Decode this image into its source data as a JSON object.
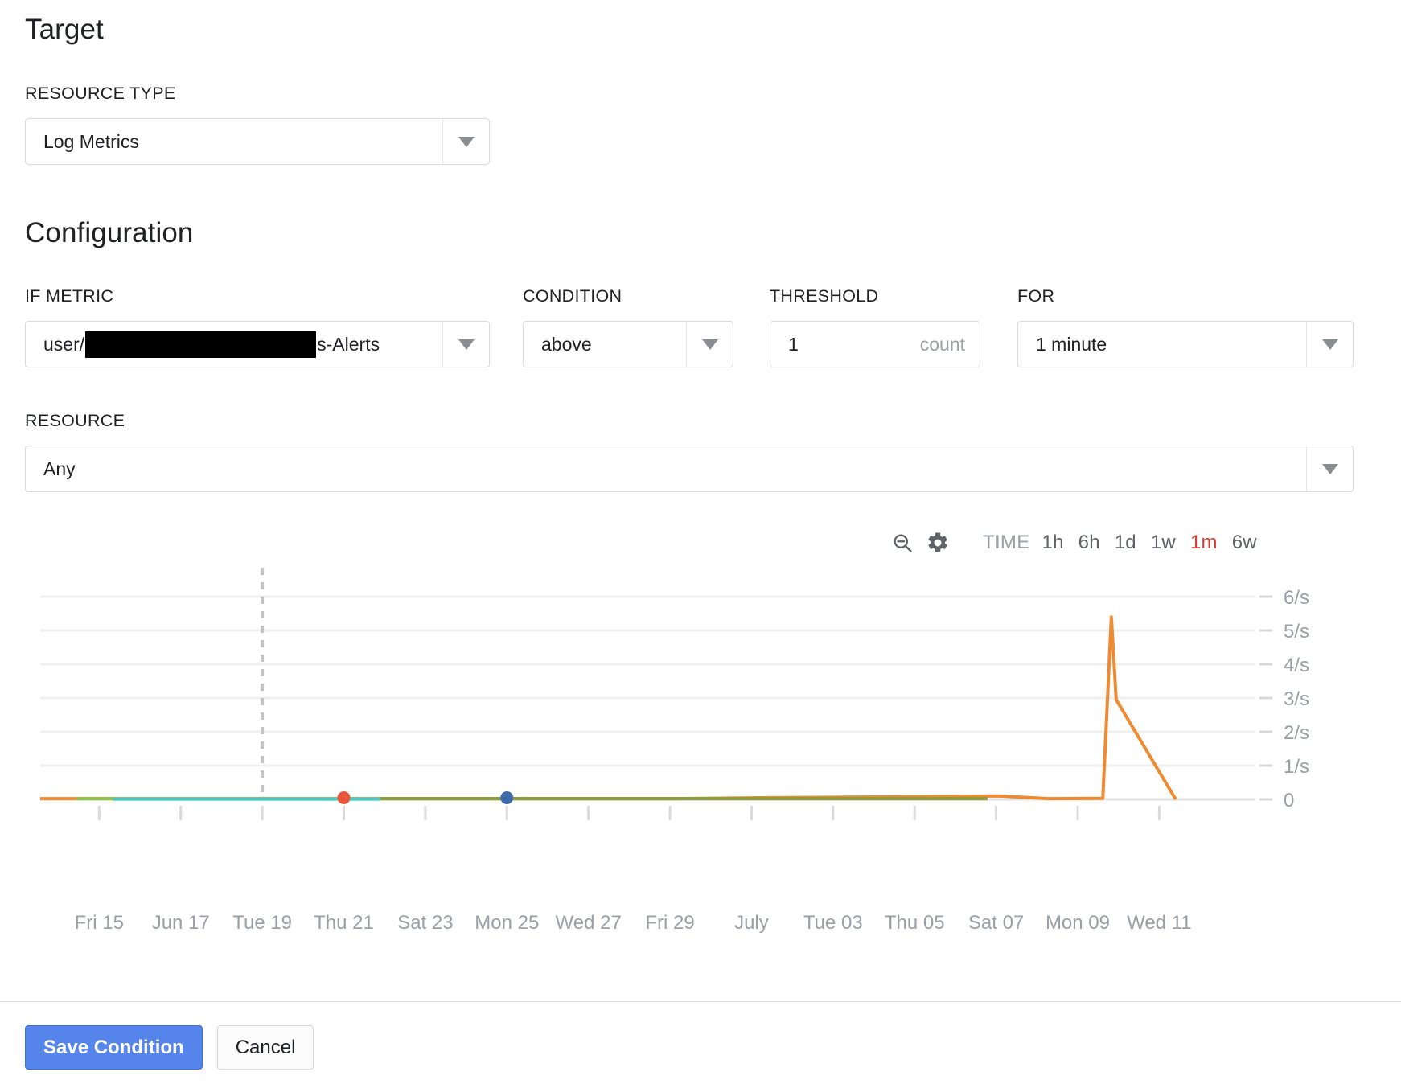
{
  "target": {
    "heading": "Target",
    "resource_type_label": "RESOURCE TYPE",
    "resource_type_value": "Log Metrics"
  },
  "configuration": {
    "heading": "Configuration",
    "if_metric_label": "IF METRIC",
    "if_metric_prefix": "user/",
    "if_metric_suffix": "s-Alerts",
    "if_metric_redacted": true,
    "condition_label": "CONDITION",
    "condition_value": "above",
    "threshold_label": "THRESHOLD",
    "threshold_value": "1",
    "threshold_unit": "count",
    "for_label": "FOR",
    "for_value": "1 minute",
    "resource_label": "RESOURCE",
    "resource_value": "Any"
  },
  "chart_toolbar": {
    "zoom_out_icon": "zoom-out-icon",
    "settings_icon": "gear-icon",
    "time_label": "TIME",
    "ranges": [
      {
        "label": "1h",
        "active": false
      },
      {
        "label": "6h",
        "active": false
      },
      {
        "label": "1d",
        "active": false
      },
      {
        "label": "1w",
        "active": false
      },
      {
        "label": "1m",
        "active": true
      },
      {
        "label": "6w",
        "active": false
      }
    ]
  },
  "footer": {
    "save_label": "Save Condition",
    "cancel_label": "Cancel"
  },
  "colors": {
    "accent_blue": "#5585ea",
    "active_range_red": "#d23f31",
    "series_orange": "#ee8b32",
    "series_green": "#8bc34a",
    "series_olive": "#8a9a3f",
    "series_teal": "#4cc6c0",
    "marker_red": "#e8553a",
    "marker_blue": "#3f6aa8",
    "gridline": "#efefef",
    "cursor_line": "#c4c4c4",
    "axis_text": "#9aa0a6"
  },
  "chart_data": {
    "type": "line",
    "title": "",
    "xlabel": "",
    "ylabel": "",
    "ylim": [
      0,
      6
    ],
    "grid": true,
    "legend_position": "none",
    "ytick_labels": [
      "6/s",
      "5/s",
      "4/s",
      "3/s",
      "2/s",
      "1/s",
      "0"
    ],
    "ytick_values": [
      6,
      5,
      4,
      3,
      2,
      1,
      0
    ],
    "xtick_labels": [
      "Fri 15",
      "Jun 17",
      "Tue 19",
      "Thu 21",
      "Sat 23",
      "Mon 25",
      "Wed 27",
      "Fri 29",
      "July",
      "Tue 03",
      "Thu 05",
      "Sat 07",
      "Mon 09",
      "Wed 11"
    ],
    "cursor_line_x_label": "Tue 19",
    "annotations": [
      {
        "name": "point-marker-red",
        "x_label": "Thu 21",
        "y": 0,
        "color": "#e8553a"
      },
      {
        "name": "point-marker-blue",
        "x_label": "Mon 25",
        "y": 0,
        "color": "#3f6aa8"
      }
    ],
    "series": [
      {
        "name": "orange",
        "color": "#ee8b32",
        "points": [
          [
            0.0,
            0.02
          ],
          [
            0.52,
            0.02
          ],
          [
            0.6,
            0.05
          ],
          [
            0.72,
            0.08
          ],
          [
            0.79,
            0.1
          ],
          [
            0.83,
            0.02
          ],
          [
            0.875,
            0.03
          ],
          [
            0.882,
            5.4
          ],
          [
            0.886,
            2.95
          ],
          [
            0.935,
            0.0
          ]
        ]
      },
      {
        "name": "green",
        "color": "#8bc34a",
        "points": [
          [
            0.03,
            0.02
          ],
          [
            0.4,
            0.02
          ],
          [
            0.78,
            0.02
          ]
        ]
      },
      {
        "name": "olive",
        "color": "#8a9a3f",
        "points": [
          [
            0.28,
            0.02
          ],
          [
            0.78,
            0.02
          ]
        ]
      },
      {
        "name": "teal",
        "color": "#4cc6c0",
        "points": [
          [
            0.06,
            0.01
          ],
          [
            0.28,
            0.01
          ]
        ]
      }
    ]
  }
}
